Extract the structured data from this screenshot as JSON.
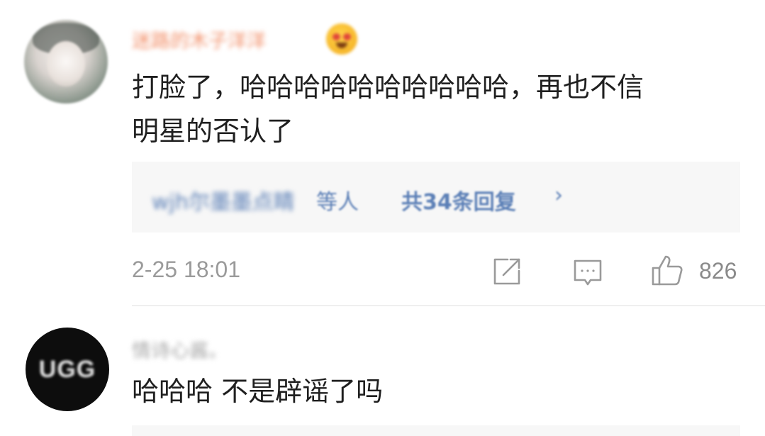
{
  "comments": [
    {
      "username": "迷路的木子洋洋",
      "emoji_icon": "heart-eyes-emoji-icon",
      "text": "打脸了，哈哈哈哈哈哈哈哈哈哈，再也不信\n明星的否认了",
      "replies": {
        "names": "wjh尔墨墨点睛",
        "etc": "等人",
        "count_label": "共34条回复",
        "chevron": "›"
      },
      "timestamp": "2-25 18:01",
      "like_count": "826"
    },
    {
      "username": "情诗心酱。",
      "avatar_text": "UGG",
      "text": "哈哈哈 不是辟谣了吗"
    }
  ],
  "colors": {
    "username_orange": "#f2906a",
    "link_blue": "#5b7fb6",
    "meta_gray": "#9a9a9a",
    "reply_bg": "#f7f7f7"
  },
  "icons": {
    "repost": "repost-icon",
    "comment": "comment-icon",
    "like": "thumbs-up-icon"
  }
}
